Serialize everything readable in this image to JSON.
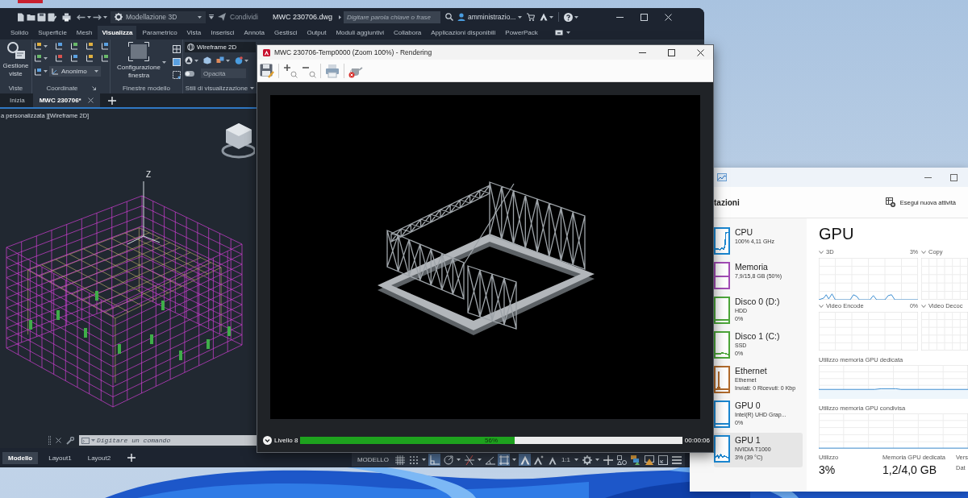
{
  "autocad": {
    "workspace": "Modellazione 3D",
    "share": "Condividi",
    "file_name": "MWC 230706.dwg",
    "search": {
      "placeholder": "Digitare parola chiave o frase"
    },
    "user": "amministrazio...",
    "ribbon_tabs": [
      {
        "label": "Solido",
        "selected": false
      },
      {
        "label": "Superficie",
        "selected": false
      },
      {
        "label": "Mesh",
        "selected": false
      },
      {
        "label": "Visualizza",
        "selected": true
      },
      {
        "label": "Parametrico",
        "selected": false
      },
      {
        "label": "Vista",
        "selected": false
      },
      {
        "label": "Inserisci",
        "selected": false
      },
      {
        "label": "Annota",
        "selected": false
      },
      {
        "label": "Gestisci",
        "selected": false
      },
      {
        "label": "Output",
        "selected": false
      },
      {
        "label": "Moduli aggiuntivi",
        "selected": false
      },
      {
        "label": "Collabora",
        "selected": false
      },
      {
        "label": "Applicazioni disponibili",
        "selected": false
      },
      {
        "label": "PowerPack",
        "selected": false
      }
    ],
    "panels": {
      "views": {
        "title": "Viste",
        "button": "Gestione viste"
      },
      "coordinates": {
        "title": "Coordinate",
        "dropdown": "Anonimo"
      },
      "viewports": {
        "title": "Finestre modello",
        "button": "Configurazione finestra"
      },
      "styles": {
        "title": "Stili di visualizzazione",
        "dropdown": "Wireframe 2D",
        "opacity": {
          "placeholder": "Opacità",
          "disabled": true
        }
      }
    },
    "file_tabs": [
      {
        "label": "Inizia",
        "selected": false
      },
      {
        "label": "MWC 230706*",
        "selected": true
      }
    ],
    "viewport": {
      "label": "a personalizzata ][Wireframe 2D]",
      "axis_label": "Z"
    },
    "command": {
      "placeholder": "Digitare un comando"
    },
    "layout_tabs": [
      {
        "label": "Modello",
        "selected": true
      },
      {
        "label": "Layout1",
        "selected": false
      },
      {
        "label": "Layout2",
        "selected": false
      }
    ],
    "status_bar": {
      "model_button": "MODELLO",
      "tools": [
        {
          "kind": "grid",
          "on": false
        },
        {
          "kind": "dot-grid",
          "on": false
        },
        {
          "kind": "dropdown",
          "on": false
        },
        {
          "kind": "right-angle",
          "on": true
        },
        {
          "kind": "circle-arrow",
          "on": false
        },
        {
          "kind": "dropdown",
          "on": false
        },
        {
          "kind": "crossed-lines",
          "on": false
        },
        {
          "kind": "dropdown",
          "on": false
        },
        {
          "kind": "angle",
          "on": false
        },
        {
          "kind": "square-corners",
          "on": true
        },
        {
          "kind": "dropdown",
          "on": false
        },
        {
          "kind": "triangle-shape",
          "on": true
        },
        {
          "kind": "triangle-sparkle",
          "on": false
        },
        {
          "kind": "small-triangle",
          "on": false
        },
        {
          "kind": "scale",
          "label": "1:1",
          "on": false
        },
        {
          "kind": "dropdown",
          "on": false
        },
        {
          "kind": "gear",
          "on": false
        },
        {
          "kind": "dropdown",
          "on": false
        },
        {
          "kind": "plus",
          "on": false
        },
        {
          "kind": "shapes",
          "on": false
        },
        {
          "kind": "overlapping-blocks",
          "on": false
        },
        {
          "kind": "screen-triangle",
          "on": false
        },
        {
          "kind": "fullscreen",
          "on": false
        },
        {
          "kind": "menu",
          "on": false
        }
      ]
    }
  },
  "render_window": {
    "title": "MWC 230706-Temp0000 (Zoom 100%) - Rendering",
    "progress": {
      "label": "Livello 8",
      "level": 0.56,
      "reading": "56%",
      "time": "00:00:06"
    }
  },
  "task_manager": {
    "section": "tazioni",
    "new_task": "Esegui nuova attività",
    "devices": [
      {
        "name": "CPU",
        "lines": [
          "100% 4,11 GHz"
        ],
        "color": "#1a86d0",
        "selected": false
      },
      {
        "name": "Memoria",
        "lines": [
          "7,9/15,8 GB (50%)"
        ],
        "color": "#a24cb5",
        "selected": false
      },
      {
        "name": "Disco 0 (D:)",
        "lines": [
          "HDD",
          "0%"
        ],
        "color": "#4da63a",
        "selected": false
      },
      {
        "name": "Disco 1 (C:)",
        "lines": [
          "SSD",
          "0%"
        ],
        "color": "#4da63a",
        "selected": false
      },
      {
        "name": "Ethernet",
        "lines": [
          "Ethernet",
          "Inviati: 0 Ricevuti: 0 Kbp"
        ],
        "color": "#b06a2c",
        "selected": false
      },
      {
        "name": "GPU 0",
        "lines": [
          "Intel(R) UHD Grap...",
          "0%"
        ],
        "color": "#1a86d0",
        "selected": false
      },
      {
        "name": "GPU 1",
        "lines": [
          "NVIDIA T1000",
          "3% (39 °C)"
        ],
        "color": "#1a86d0",
        "selected": true
      }
    ],
    "gpu": {
      "title": "GPU",
      "engines": [
        {
          "name": "3D",
          "value": "3%"
        },
        {
          "name": "Copy"
        },
        {
          "name": "Video Encode",
          "value": "0%"
        },
        {
          "name": "Video Decoc"
        }
      ],
      "dedicated_label": "Utilizzo memoria GPU dedicata",
      "shared_label": "Utilizzo memoria GPU condivisa",
      "stats": [
        {
          "label": "Utilizzo",
          "value": "3%"
        },
        {
          "label": "Memoria GPU dedicata",
          "value": "1,2/4,0 GB"
        }
      ],
      "side_labels": [
        "Vers",
        "Dat"
      ]
    }
  }
}
